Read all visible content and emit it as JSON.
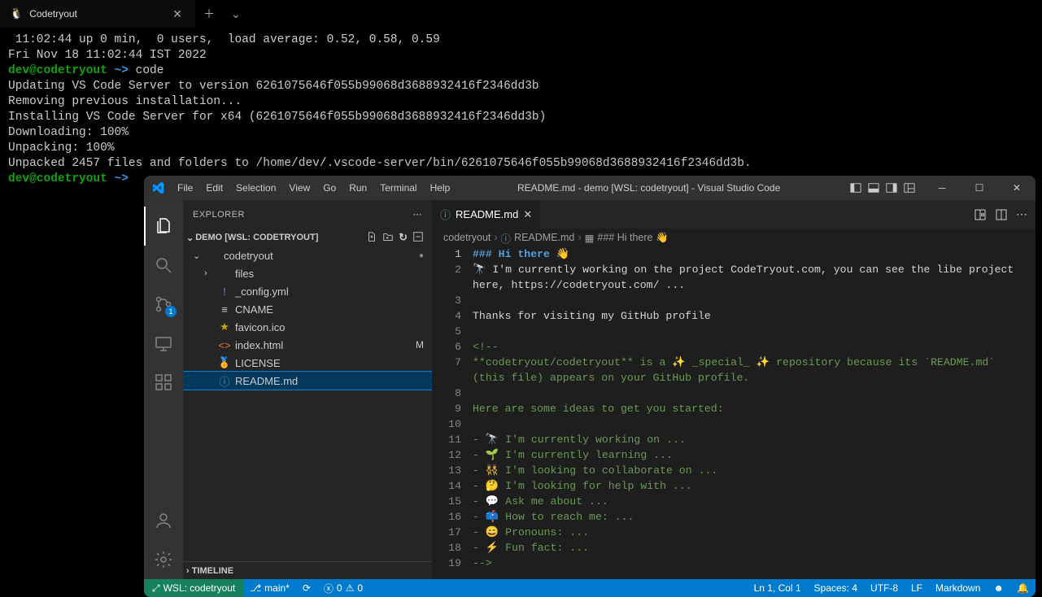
{
  "terminal": {
    "tab_title": "Codetryout",
    "lines": [
      {
        "segments": [
          {
            "t": " 11:02:44 up 0 min,  0 users,  load average: 0.52, 0.58, 0.59",
            "c": ""
          }
        ]
      },
      {
        "segments": [
          {
            "t": "Fri Nov 18 11:02:44 IST 2022",
            "c": ""
          }
        ]
      },
      {
        "segments": [
          {
            "t": "dev@codetryout",
            "c": "term-green"
          },
          {
            "t": " ",
            "c": ""
          },
          {
            "t": "~>",
            "c": "term-cyan"
          },
          {
            "t": " code",
            "c": ""
          }
        ]
      },
      {
        "segments": [
          {
            "t": "Updating VS Code Server to version 6261075646f055b99068d3688932416f2346dd3b",
            "c": ""
          }
        ]
      },
      {
        "segments": [
          {
            "t": "Removing previous installation...",
            "c": ""
          }
        ]
      },
      {
        "segments": [
          {
            "t": "Installing VS Code Server for x64 (6261075646f055b99068d3688932416f2346dd3b)",
            "c": ""
          }
        ]
      },
      {
        "segments": [
          {
            "t": "Downloading: 100%",
            "c": ""
          }
        ]
      },
      {
        "segments": [
          {
            "t": "Unpacking: 100%",
            "c": ""
          }
        ]
      },
      {
        "segments": [
          {
            "t": "Unpacked 2457 files and folders to /home/dev/.vscode-server/bin/6261075646f055b99068d3688932416f2346dd3b.",
            "c": ""
          }
        ]
      },
      {
        "segments": [
          {
            "t": "dev@codetryout",
            "c": "term-green"
          },
          {
            "t": " ",
            "c": ""
          },
          {
            "t": "~>",
            "c": "term-cyan"
          }
        ]
      }
    ]
  },
  "vscode": {
    "menus": [
      "File",
      "Edit",
      "Selection",
      "View",
      "Go",
      "Run",
      "Terminal",
      "Help"
    ],
    "title": "README.md - demo [WSL: codetryout] - Visual Studio Code",
    "explorer_label": "EXPLORER",
    "workspace_label": "DEMO [WSL: CODETRYOUT]",
    "scm_badge": "1",
    "tree": [
      {
        "depth": 0,
        "chev": "⌄",
        "icon": "",
        "name": "codetryout",
        "status_dot": true
      },
      {
        "depth": 1,
        "chev": "›",
        "icon": "",
        "name": "files"
      },
      {
        "depth": 1,
        "chev": "",
        "icon": "!",
        "icolor": "ic-purple",
        "name": "_config.yml"
      },
      {
        "depth": 1,
        "chev": "",
        "icon": "≡",
        "icolor": "",
        "name": "CNAME"
      },
      {
        "depth": 1,
        "chev": "",
        "icon": "★",
        "icolor": "ic-yellow",
        "name": "favicon.ico"
      },
      {
        "depth": 1,
        "chev": "",
        "icon": "<>",
        "icolor": "ic-orange",
        "name": "index.html",
        "status": "M"
      },
      {
        "depth": 1,
        "chev": "",
        "icon": "🏅",
        "icolor": "ic-yellow",
        "name": "LICENSE"
      },
      {
        "depth": 1,
        "chev": "",
        "icon": "ⓘ",
        "icolor": "ic-blue",
        "name": "README.md",
        "selected": true
      }
    ],
    "timeline_label": "TIMELINE",
    "tab": {
      "icon": "ⓘ",
      "label": "README.md"
    },
    "breadcrumb": [
      "codetryout",
      "README.md",
      "### Hi there 👋"
    ],
    "code": [
      {
        "n": 1,
        "cls": "md-h",
        "t": "### Hi there 👋"
      },
      {
        "n": 2,
        "cls": "md-txt",
        "t": "🔭 I'm currently working on the project CodeTryout.com, you can see the libe project here, https://codetryout.com/ ..."
      },
      {
        "n": 3,
        "cls": "",
        "t": ""
      },
      {
        "n": 4,
        "cls": "md-txt",
        "t": "Thanks for visiting my GitHub profile"
      },
      {
        "n": 5,
        "cls": "",
        "t": ""
      },
      {
        "n": 6,
        "cls": "md-comment",
        "t": "<!--"
      },
      {
        "n": 7,
        "cls": "md-comment",
        "t": "**codetryout/codetryout** is a ✨ _special_ ✨ repository because its `README.md` (this file) appears on your GitHub profile."
      },
      {
        "n": 8,
        "cls": "",
        "t": ""
      },
      {
        "n": 9,
        "cls": "md-comment",
        "t": "Here are some ideas to get you started:"
      },
      {
        "n": 10,
        "cls": "",
        "t": ""
      },
      {
        "n": 11,
        "cls": "md-comment",
        "t": "- 🔭 I'm currently working on ..."
      },
      {
        "n": 12,
        "cls": "md-comment",
        "t": "- 🌱 I'm currently learning ..."
      },
      {
        "n": 13,
        "cls": "md-comment",
        "t": "- 👯 I'm looking to collaborate on ..."
      },
      {
        "n": 14,
        "cls": "md-comment",
        "t": "- 🤔 I'm looking for help with ..."
      },
      {
        "n": 15,
        "cls": "md-comment",
        "t": "- 💬 Ask me about ..."
      },
      {
        "n": 16,
        "cls": "md-comment",
        "t": "- 📫 How to reach me: ..."
      },
      {
        "n": 17,
        "cls": "md-comment",
        "t": "- 😄 Pronouns: ..."
      },
      {
        "n": 18,
        "cls": "md-comment",
        "t": "- ⚡ Fun fact: ..."
      },
      {
        "n": 19,
        "cls": "md-comment",
        "t": "-->"
      }
    ],
    "status": {
      "remote": "WSL: codetryout",
      "branch": "main*",
      "sync": "⟳",
      "errors": "0",
      "warnings": "0",
      "lncol": "Ln 1, Col 1",
      "spaces": "Spaces: 4",
      "encoding": "UTF-8",
      "eol": "LF",
      "lang": "Markdown"
    }
  }
}
